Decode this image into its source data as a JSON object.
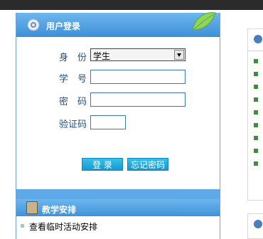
{
  "login": {
    "title": "用户登录",
    "identity_label": "身　份",
    "identity_value": "学生",
    "student_id_label": "学　号",
    "password_label": "密　码",
    "captcha_label": "验证码",
    "login_button": "登 录",
    "forgot_button": "忘记密码"
  },
  "teaching": {
    "title": "教学安排",
    "items": [
      "查看临时活动安排"
    ]
  },
  "colors": {
    "header_blue": "#3d8fd6",
    "button_blue": "#1599d2",
    "label_blue": "#1f4f8f"
  },
  "icons": [
    "gear-icon",
    "leaf-icon",
    "book-icon",
    "dropdown-arrow-icon"
  ]
}
